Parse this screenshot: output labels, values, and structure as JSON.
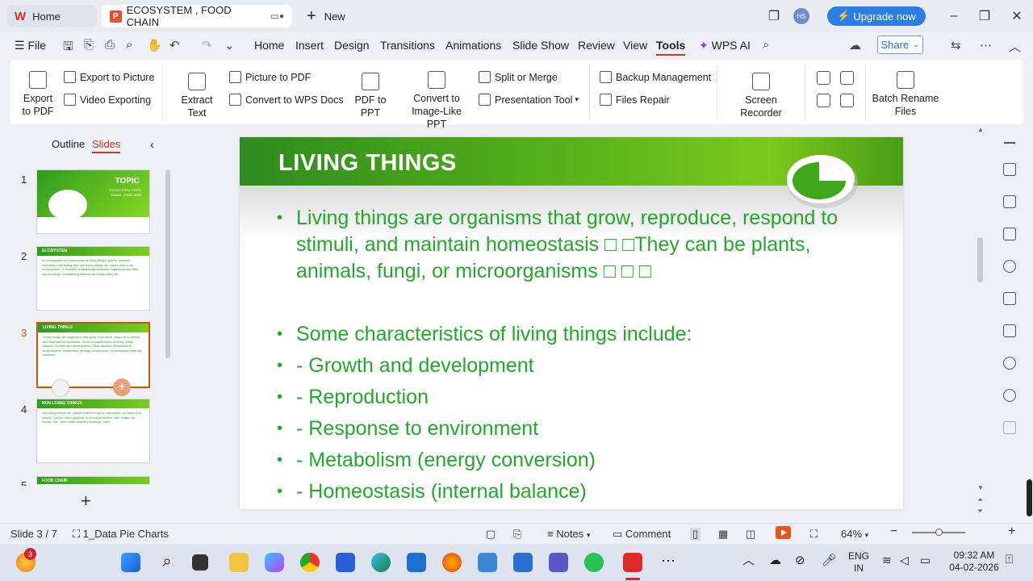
{
  "titlebar": {
    "home_tab": "Home",
    "doc_tab": "ECOSYSTEM , FOOD CHAIN",
    "new_tab": "New",
    "avatar_initials": "HS",
    "upgrade_label": "Upgrade now"
  },
  "menu": {
    "file": "File",
    "items": [
      "Home",
      "Insert",
      "Design",
      "Transitions",
      "Animations",
      "Slide Show",
      "Review",
      "View",
      "Tools",
      "WPS AI"
    ],
    "active": "Tools",
    "share": "Share"
  },
  "ribbon": {
    "export_pdf": "Export to PDF",
    "export_picture": "Export to Picture",
    "video_exporting": "Video  Exporting",
    "extract_text": "Extract Text",
    "picture_to_pdf": "Picture to PDF",
    "convert_wps_docs": "Convert to WPS Docs",
    "pdf_to_ppt": "PDF to PPT",
    "convert_image_ppt": "Convert to Image-Like PPT",
    "split_merge": "Split or Merge",
    "presentation_tool": "Presentation Tool",
    "backup_management": "Backup Management",
    "files_repair": "Files Repair",
    "screen_recorder": "Screen Recorder",
    "batch_rename": "Batch Rename Files"
  },
  "panel": {
    "outline_tab": "Outline",
    "slides_tab": "Slides",
    "thumbs": [
      {
        "num": "1",
        "title": "TOPIC",
        "text": "ECOSYSTEM, FOOD CHAIN , FOOD WEB"
      },
      {
        "num": "2",
        "title": "ECOSYSTEM",
        "text": "An ecosystem is a community of living things (plants, animals, microbes) interacting with non-living things (air, water, soil) in an environment . It includes relationships between organisms and their surroundings, maintaining balance and supporting life."
      },
      {
        "num": "3",
        "title": "LIVING THINGS",
        "text": "Living things are organisms that grow, reproduce, respond to stimuli, and maintain homeostasis. Some characteristics of living things include: Growth and development, Reproduction, Response to environment, Metabolism (energy conversion), Homeostasis (internal balance)"
      },
      {
        "num": "4",
        "title": "NON LIVING THINGS",
        "text": "Non-living things are objects that don't grow, reproduce, or respond to stimuli. They're often physical or chemical entities, like: Water, Air, Rocks, Soil, Man-made objects (buildings, cars)"
      },
      {
        "num": "5",
        "title": "FOOD CHAIN",
        "text": ""
      }
    ]
  },
  "slide": {
    "title": "LIVING THINGS",
    "bullets": [
      "Living things are organisms that grow, reproduce, respond to stimuli, and maintain homeostasis □ □They can be plants, animals, fungi, or microorganisms □ □ □",
      "Some characteristics of living things include:",
      "- Growth and development",
      "- Reproduction",
      "- Response to environment",
      "- Metabolism (energy conversion)",
      "- Homeostasis (internal balance)"
    ],
    "colors": {
      "bar_start": "#2e8b1e",
      "bar_end": "#7bc91c",
      "text": "#22a82a"
    }
  },
  "status": {
    "slide_counter": "Slide 3 / 7",
    "theme": "1_Data Pie Charts",
    "notes": "Notes",
    "comment": "Comment",
    "zoom": "64%"
  },
  "taskbar": {
    "notif_count": "3",
    "lang": "ENG",
    "region": "IN",
    "time": "09:32 AM",
    "date": "04-02-2026"
  }
}
